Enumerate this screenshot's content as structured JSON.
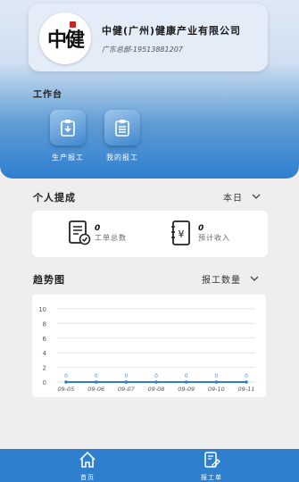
{
  "company": {
    "logo_text": "中健",
    "name": "中健(广州)健康产业有限公司",
    "subtitle": "广东总部-19513881207"
  },
  "workbench": {
    "title": "工作台",
    "buttons": [
      {
        "label": "生产报工",
        "icon": "clipboard-download-icon"
      },
      {
        "label": "我的报工",
        "icon": "clipboard-list-icon"
      }
    ]
  },
  "performance": {
    "title": "个人提成",
    "period": "本日",
    "stats": [
      {
        "value": "0",
        "label": "工单总数",
        "icon": "document-check-icon"
      },
      {
        "value": "0",
        "label": "预计收入",
        "icon": "yen-notebook-icon"
      }
    ]
  },
  "trend": {
    "title": "趋势图",
    "metric": "报工数量"
  },
  "chart_data": {
    "type": "line",
    "categories": [
      "09-05",
      "09-06",
      "09-07",
      "09-08",
      "09-09",
      "09-10",
      "09-11"
    ],
    "series": [
      {
        "values": [
          0,
          0,
          0,
          0,
          0,
          0,
          0
        ]
      }
    ],
    "yticks": [
      "10",
      "8",
      "6",
      "4",
      "2",
      "0"
    ],
    "ylim": [
      0,
      10
    ],
    "grid": true,
    "color": "#2f7fcf"
  },
  "nav": {
    "items": [
      {
        "label": "首页",
        "icon": "home-icon"
      },
      {
        "label": "报工单",
        "icon": "edit-document-icon"
      }
    ]
  }
}
